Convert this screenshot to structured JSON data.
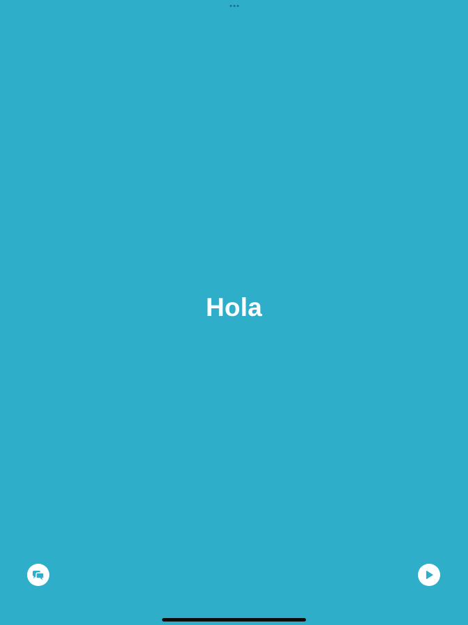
{
  "app": {
    "display_phrase": "Hola"
  },
  "icons": {
    "left_button": "speech-bubbles-icon",
    "right_button": "play-icon"
  },
  "colors": {
    "background": "#2faec9",
    "text": "#ffffff",
    "button_fill": "#ffffff",
    "icon_color": "#2faec9",
    "home_indicator": "#0b0b0b"
  }
}
